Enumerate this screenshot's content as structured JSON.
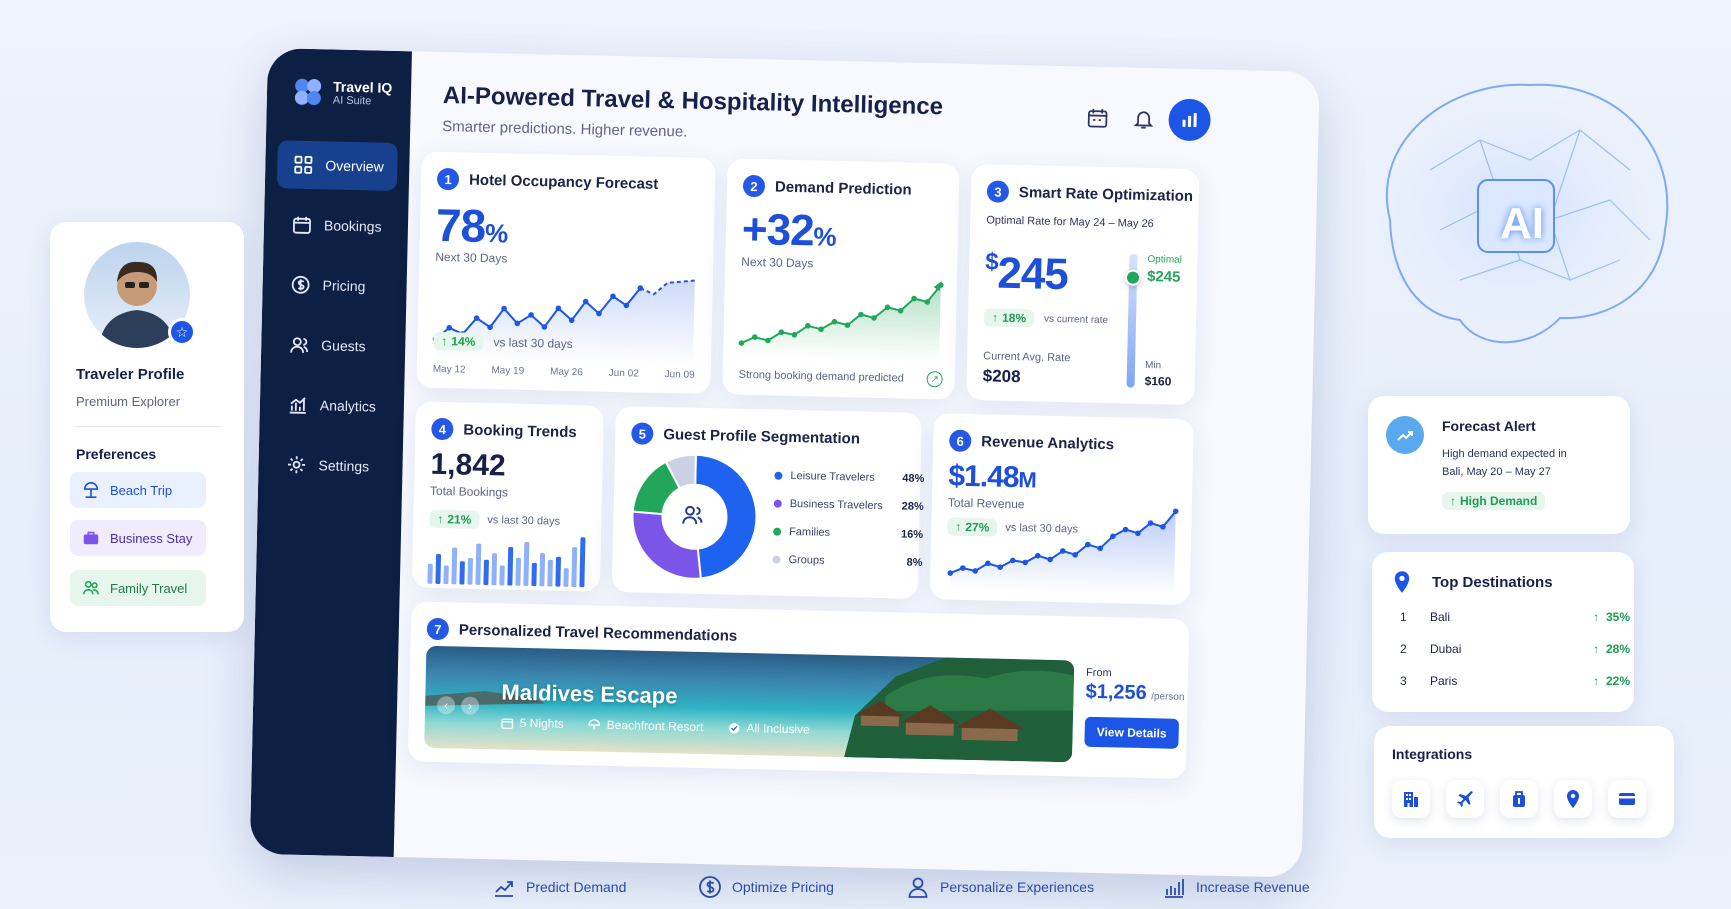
{
  "sidebar": {
    "brand": {
      "name": "Travel IQ",
      "tagline": "AI Suite"
    },
    "items": [
      {
        "label": "Overview",
        "icon": "grid-icon",
        "active": true
      },
      {
        "label": "Bookings",
        "icon": "calendar-icon"
      },
      {
        "label": "Pricing",
        "icon": "dollar-icon"
      },
      {
        "label": "Guests",
        "icon": "users-icon"
      },
      {
        "label": "Analytics",
        "icon": "bar-chart-icon"
      },
      {
        "label": "Settings",
        "icon": "gear-icon"
      }
    ]
  },
  "header": {
    "title": "AI-Powered Travel & Hospitality Intelligence",
    "subtitle": "Smarter predictions. Higher revenue."
  },
  "occupancy": {
    "num": "1",
    "title": "Hotel Occupancy Forecast",
    "value": "78",
    "unit": "%",
    "period": "Next 30 Days",
    "change": "14%",
    "change_label": "vs last 30 days",
    "x_labels": [
      "May 12",
      "May 19",
      "May 26",
      "Jun 02",
      "Jun 09"
    ]
  },
  "demand": {
    "num": "2",
    "title": "Demand Prediction",
    "value": "+32",
    "unit": "%",
    "period": "Next 30 Days",
    "note": "Strong booking demand predicted"
  },
  "rate": {
    "num": "3",
    "title": "Smart Rate Optimization",
    "range": "Optimal Rate for May 24 – May 26",
    "currency": "$",
    "value": "245",
    "change": "18%",
    "change_label": "vs current rate",
    "current_label": "Current Avg. Rate",
    "current_value": "$208",
    "optimal_label": "Optimal",
    "optimal_value": "$245",
    "min_label": "Min",
    "min_value": "$160"
  },
  "bookings": {
    "num": "4",
    "title": "Booking Trends",
    "value": "1,842",
    "label": "Total Bookings",
    "change": "21%",
    "change_label": "vs last 30 days"
  },
  "segmentation": {
    "num": "5",
    "title": "Guest Profile Segmentation",
    "segments": [
      {
        "name": "Leisure Travelers",
        "pct": "48%",
        "value": 48,
        "color": "#1e63f0"
      },
      {
        "name": "Business Travelers",
        "pct": "28%",
        "value": 28,
        "color": "#7b55e8"
      },
      {
        "name": "Families",
        "pct": "16%",
        "value": 16,
        "color": "#22a65a"
      },
      {
        "name": "Groups",
        "pct": "8%",
        "value": 8,
        "color": "#c9d1e2"
      }
    ]
  },
  "revenue": {
    "num": "6",
    "title": "Revenue Analytics",
    "value": "$1.48",
    "unit": "M",
    "label": "Total Revenue",
    "change": "27%",
    "change_label": "vs last 30 days"
  },
  "recommendations": {
    "num": "7",
    "title": "Personalized Travel Recommendations",
    "dest_title": "Maldives Escape",
    "features": [
      "5 Nights",
      "Beachfront Resort",
      "All Inclusive"
    ],
    "from_label": "From",
    "price": "$1,256",
    "per": "/person",
    "cta": "View Details"
  },
  "profile": {
    "title": "Traveler Profile",
    "subtitle": "Premium Explorer",
    "prefs_title": "Preferences",
    "prefs": [
      {
        "label": "Beach Trip",
        "icon": "umbrella-icon"
      },
      {
        "label": "Business Stay",
        "icon": "briefcase-icon"
      },
      {
        "label": "Family Travel",
        "icon": "family-icon"
      }
    ]
  },
  "ai_badge": "AI",
  "forecast_alert": {
    "title": "Forecast Alert",
    "text_line1": "High demand expected in",
    "text_line2": "Bali, May 20 – May 27",
    "badge": "High Demand"
  },
  "destinations": {
    "title": "Top Destinations",
    "items": [
      {
        "rank": "1",
        "name": "Bali",
        "change": "35%"
      },
      {
        "rank": "2",
        "name": "Dubai",
        "change": "28%"
      },
      {
        "rank": "3",
        "name": "Paris",
        "change": "22%"
      }
    ]
  },
  "integrations": {
    "title": "Integrations",
    "icons": [
      "hotel-icon",
      "plane-icon",
      "luggage-icon",
      "location-pin-icon",
      "credit-card-icon"
    ]
  },
  "features_bar": [
    {
      "label": "Predict Demand",
      "icon": "trend-chart-icon"
    },
    {
      "label": "Optimize Pricing",
      "icon": "dollar-circle-icon"
    },
    {
      "label": "Personalize Experiences",
      "icon": "person-icon"
    },
    {
      "label": "Increase Revenue",
      "icon": "revenue-bars-icon"
    }
  ],
  "chart_data": [
    {
      "type": "line",
      "title": "Hotel Occupancy Forecast",
      "series": [
        {
          "values": [
            40,
            48,
            44,
            55,
            49,
            62,
            52,
            58,
            50,
            63,
            55,
            68,
            60,
            72,
            66,
            78,
            74,
            82,
            83,
            84
          ]
        }
      ],
      "ylim": [
        30,
        90
      ],
      "x_ticks": [
        "May 12",
        "May 19",
        "May 26",
        "Jun 02",
        "Jun 09"
      ]
    },
    {
      "type": "area",
      "title": "Demand Prediction",
      "series": [
        {
          "values": [
            10,
            18,
            14,
            25,
            22,
            34,
            30,
            40,
            36,
            50,
            46,
            60,
            56,
            72,
            68,
            90
          ]
        }
      ],
      "ylim": [
        0,
        100
      ]
    },
    {
      "type": "bar",
      "title": "Booking Trends",
      "values": [
        30,
        45,
        28,
        55,
        35,
        40,
        62,
        38,
        48,
        30,
        58,
        42,
        66,
        35,
        50,
        40,
        45,
        28,
        60,
        75
      ]
    },
    {
      "type": "pie",
      "title": "Guest Profile Segmentation",
      "categories": [
        "Leisure Travelers",
        "Business Travelers",
        "Families",
        "Groups"
      ],
      "values": [
        48,
        28,
        16,
        8
      ]
    },
    {
      "type": "area",
      "title": "Revenue Analytics",
      "series": [
        {
          "values": [
            12,
            18,
            15,
            24,
            20,
            28,
            26,
            34,
            30,
            40,
            36,
            48,
            44,
            58,
            66,
            62,
            74,
            70,
            88
          ]
        }
      ],
      "ylim": [
        0,
        100
      ]
    }
  ]
}
